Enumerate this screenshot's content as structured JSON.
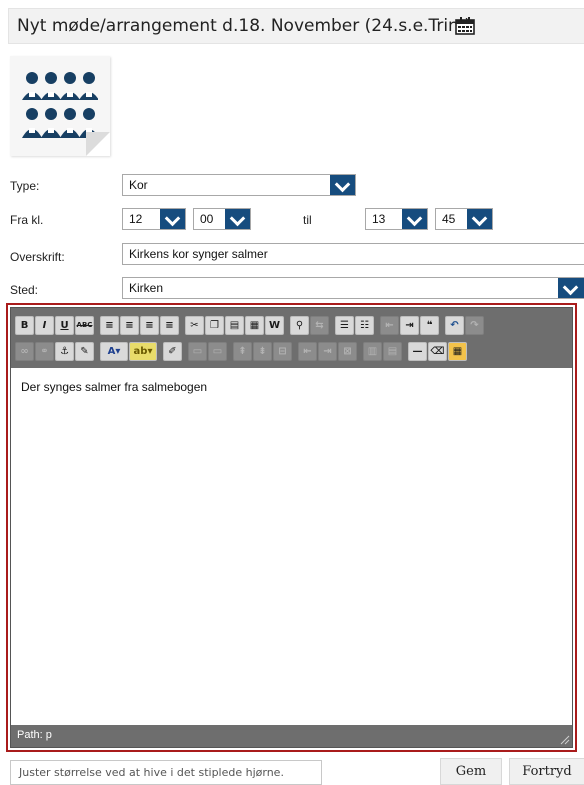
{
  "header": {
    "title": "Nyt møde/arrangement d.18. November (24.s.e.Trin.)",
    "calendar_icon": "calendar-icon"
  },
  "form": {
    "type_label": "Type:",
    "type_value": "Kor",
    "from_label": "Fra kl.",
    "from_hour": "12",
    "from_minute": "00",
    "to_label": "til",
    "to_hour": "13",
    "to_minute": "45",
    "heading_label": "Overskrift:",
    "heading_value": "Kirkens kor synger salmer",
    "place_label": "Sted:",
    "place_value": "Kirken"
  },
  "editor": {
    "content": "Der synges salmer fra salmebogen",
    "path": "Path: p"
  },
  "footer": {
    "hint": "Juster størrelse ved at hive i det stiplede hjørne.",
    "save_label": "Gem",
    "cancel_label": "Fortryd"
  },
  "colors": {
    "accent_blue": "#164c7e",
    "highlight_red": "#a91b1b",
    "toolbar_gray": "#6e6e6e"
  }
}
